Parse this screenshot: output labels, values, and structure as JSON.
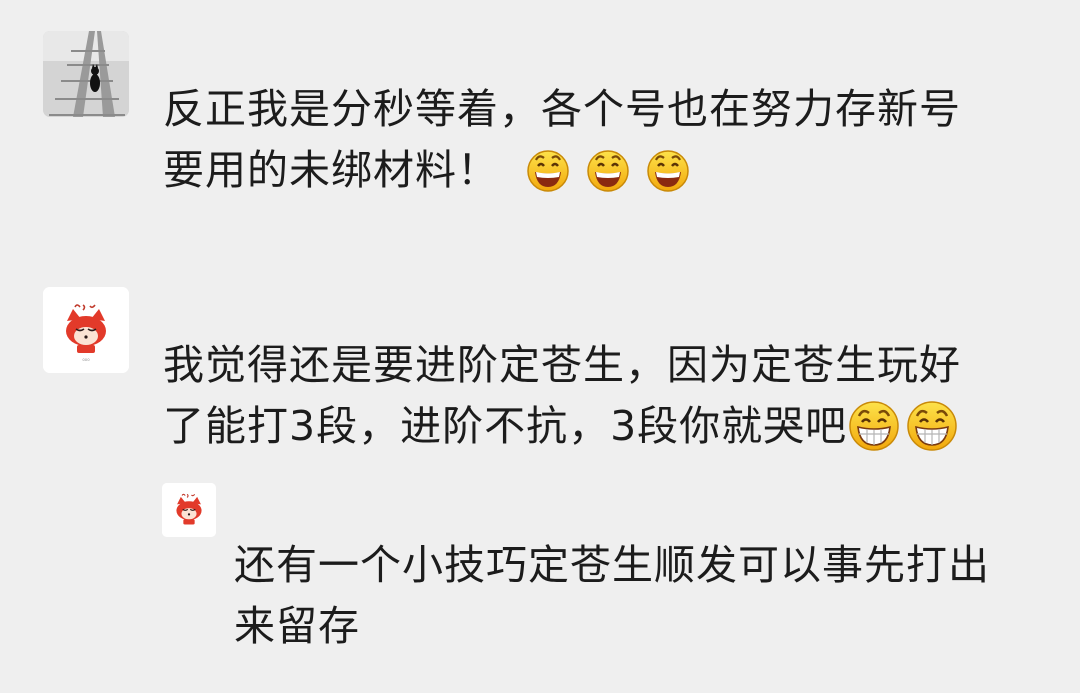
{
  "theme": {
    "background": "#efefef",
    "emoji_yellow": "#f7c31c",
    "fox_red": "#e23a2a"
  },
  "comments": [
    {
      "avatar_icon": "black-cat-on-rail-track-photo",
      "lines": [
        "反正我是分秒等着，各个号也在努力存新号",
        "要用的未绑材料！"
      ],
      "trailing_emoji": [
        "grin-emoji",
        "grin-emoji",
        "grin-emoji"
      ]
    },
    {
      "avatar_icon": "red-fox-cartoon-avatar",
      "lines": [
        "我觉得还是要进阶定苍生，因为定苍生玩好",
        "了能打3段，进阶不抗，3段你就哭吧"
      ],
      "trailing_emoji": [
        "big-grin-emoji",
        "big-grin-emoji"
      ]
    },
    {
      "avatar_icon": "red-fox-cartoon-avatar",
      "lines": [
        "还有一个小技巧定苍生顺发可以事先打出",
        "来留存"
      ],
      "trailing_emoji": []
    }
  ]
}
